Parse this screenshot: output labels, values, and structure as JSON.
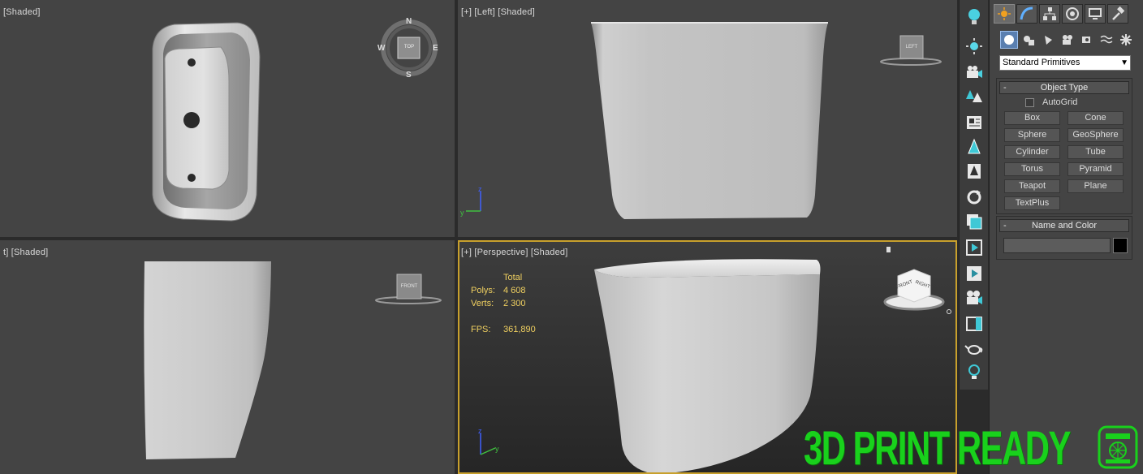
{
  "viewports": {
    "top": {
      "label": "[Shaded]",
      "compass": [
        "N",
        "E",
        "S",
        "W"
      ],
      "cube_face": "TOP"
    },
    "left": {
      "label": "[+] [Left] [Shaded]",
      "cube_face": "LEFT"
    },
    "front": {
      "label": "t] [Shaded]",
      "cube_face": "FRONT"
    },
    "perspective": {
      "label": "[+] [Perspective] [Shaded]",
      "cube_faces": [
        "FRONT",
        "RIGHT"
      ],
      "stats": {
        "header": "Total",
        "polys_label": "Polys:",
        "polys_value": "4 608",
        "verts_label": "Verts:",
        "verts_value": "2 300",
        "fps_label": "FPS:",
        "fps_value": "361,890"
      }
    }
  },
  "toolbar": {
    "icons": [
      "light-bulb-icon",
      "sun-icon",
      "camera-icon",
      "trees-icon",
      "panel-icon",
      "pine-icon",
      "tree-icon",
      "orbit-icon",
      "layers-icon",
      "play-panel-icon",
      "media-icon",
      "camera-rig-icon",
      "frame-icon",
      "teapot-icon",
      "bulb-small-icon"
    ]
  },
  "command_panel": {
    "tabs": [
      "create-tab",
      "modify-tab",
      "hierarchy-tab",
      "motion-tab",
      "display-tab",
      "utilities-tab"
    ],
    "subcategories": [
      "geometry-icon",
      "shapes-icon",
      "lights-icon",
      "cameras-icon",
      "helpers-icon",
      "spacewarps-icon",
      "systems-icon"
    ],
    "category": "Standard Primitives",
    "object_type": {
      "title": "Object Type",
      "autogrid": "AutoGrid",
      "buttons": [
        "Box",
        "Cone",
        "Sphere",
        "GeoSphere",
        "Cylinder",
        "Tube",
        "Torus",
        "Pyramid",
        "Teapot",
        "Plane",
        "TextPlus"
      ]
    },
    "name_and_color": {
      "title": "Name and Color",
      "name_value": "",
      "color": "#000000"
    }
  },
  "brand": {
    "text": "3D PRINT READY",
    "color": "#19d11c"
  }
}
